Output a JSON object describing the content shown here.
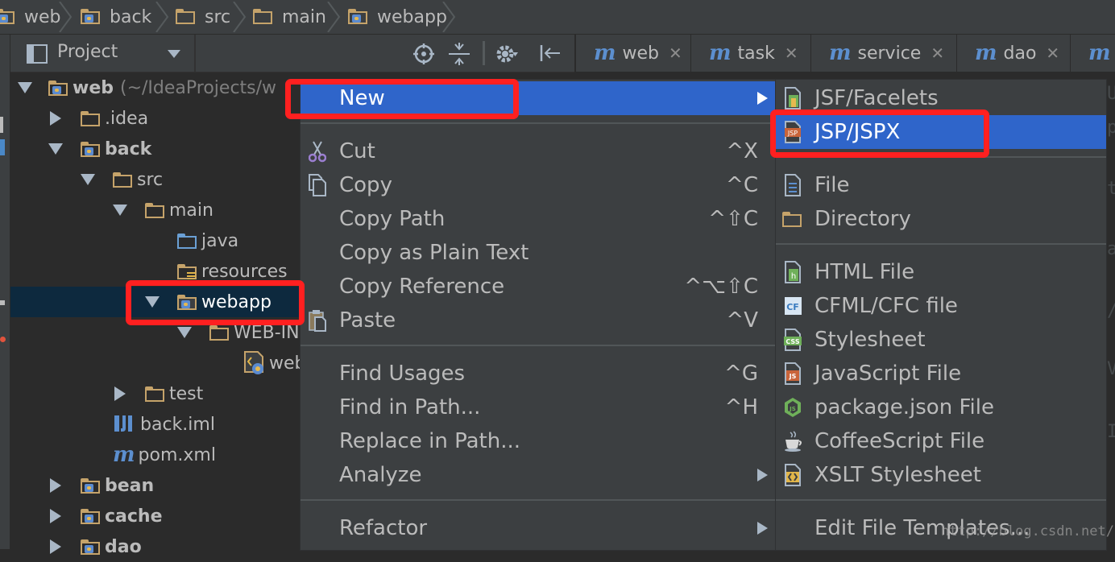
{
  "breadcrumbs": [
    "web",
    "back",
    "src",
    "main",
    "webapp"
  ],
  "project_panel": {
    "title": "Project",
    "tree": [
      {
        "label": "web",
        "suffix": "(~/IdeaProjects/w",
        "expanded": true
      },
      {
        "label": ".idea",
        "expanded": false
      },
      {
        "label": "back",
        "expanded": true
      },
      {
        "label": "src",
        "expanded": true
      },
      {
        "label": "main",
        "expanded": true
      },
      {
        "label": "java"
      },
      {
        "label": "resources"
      },
      {
        "label": "webapp",
        "expanded": true
      },
      {
        "label": "WEB-IN",
        "expanded": true
      },
      {
        "label": "web"
      },
      {
        "label": "test",
        "expanded": false
      },
      {
        "label": "back.iml"
      },
      {
        "label": "pom.xml"
      },
      {
        "label": "bean",
        "expanded": false
      },
      {
        "label": "cache",
        "expanded": false
      },
      {
        "label": "dao",
        "expanded": false
      }
    ]
  },
  "editor_tabs": [
    {
      "label": "web"
    },
    {
      "label": "task"
    },
    {
      "label": "service"
    },
    {
      "label": "dao"
    }
  ],
  "context_menu": {
    "items": [
      {
        "label": "New",
        "shortcut": ""
      },
      {
        "label": "Cut",
        "shortcut": "^X"
      },
      {
        "label": "Copy",
        "shortcut": "^C"
      },
      {
        "label": "Copy Path",
        "shortcut": "^⇧C"
      },
      {
        "label": "Copy as Plain Text",
        "shortcut": ""
      },
      {
        "label": "Copy Reference",
        "shortcut": "^⌥⇧C"
      },
      {
        "label": "Paste",
        "shortcut": "^V"
      },
      {
        "label": "Find Usages",
        "shortcut": "^G"
      },
      {
        "label": "Find in Path...",
        "shortcut": "^H"
      },
      {
        "label": "Replace in Path...",
        "shortcut": ""
      },
      {
        "label": "Analyze",
        "shortcut": ""
      },
      {
        "label": "Refactor",
        "shortcut": ""
      }
    ]
  },
  "new_submenu": {
    "items": [
      {
        "label": "JSF/Facelets"
      },
      {
        "label": "JSP/JSPX"
      },
      {
        "label": "File"
      },
      {
        "label": "Directory"
      },
      {
        "label": "HTML File"
      },
      {
        "label": "CFML/CFC file"
      },
      {
        "label": "Stylesheet"
      },
      {
        "label": "JavaScript File"
      },
      {
        "label": "package.json File"
      },
      {
        "label": "CoffeeScript File"
      },
      {
        "label": "XSLT Stylesheet"
      },
      {
        "label": "Edit File Templates..."
      }
    ]
  },
  "watermark": "http://blog.csdn.net/",
  "colors": {
    "highlight": "#2f65ca",
    "annotation": "#ff2020",
    "folder": "#c5a36a",
    "maven_m": "#5c8fcf"
  }
}
